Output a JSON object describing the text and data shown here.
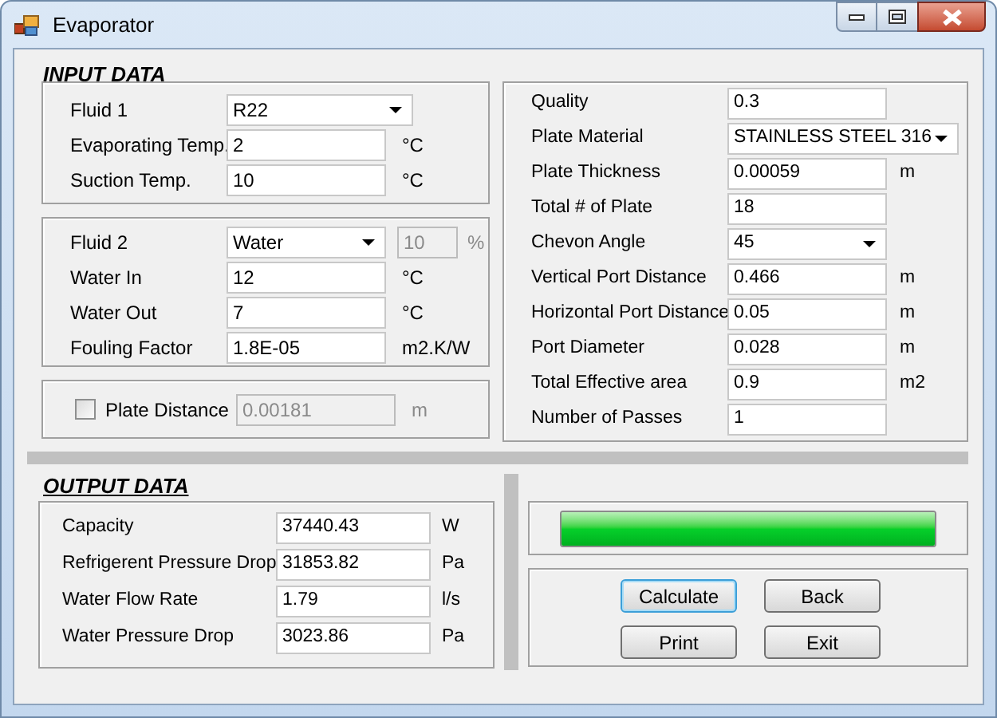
{
  "window": {
    "title": "Evaporator"
  },
  "input_heading": "INPUT DATA",
  "fluid1_group": {
    "fields": [
      {
        "label": "Fluid 1",
        "value": "R22",
        "kind": "combo"
      },
      {
        "label": "Evaporating Temp.",
        "value": "2",
        "unit": "°C",
        "kind": "text"
      },
      {
        "label": "Suction Temp.",
        "value": "10",
        "unit": "°C",
        "kind": "text"
      }
    ]
  },
  "fluid2_group": {
    "fields": [
      {
        "label": "Fluid 2",
        "value": "Water",
        "kind": "combo",
        "concentration": {
          "value": "10",
          "unit": "%",
          "disabled": true
        }
      },
      {
        "label": "Water In",
        "value": "12",
        "unit": "°C",
        "kind": "text"
      },
      {
        "label": "Water Out",
        "value": "7",
        "unit": "°C",
        "kind": "text"
      },
      {
        "label": "Fouling Factor",
        "value": "1.8E-05",
        "unit": "m2.K/W",
        "kind": "text"
      }
    ]
  },
  "plate_distance": {
    "label": "Plate Distance",
    "checked": false,
    "value": "0.00181",
    "unit": "m",
    "disabled": true
  },
  "plate_group": {
    "fields": [
      {
        "label": "Quality",
        "value": "0.3",
        "kind": "text"
      },
      {
        "label": "Plate Material",
        "value": "STAINLESS STEEL 316",
        "kind": "combo"
      },
      {
        "label": "Plate Thickness",
        "value": "0.00059",
        "unit": "m",
        "kind": "text"
      },
      {
        "label": "Total # of Plate",
        "value": "18",
        "kind": "text"
      },
      {
        "label": "Chevon Angle",
        "value": "45",
        "kind": "combo"
      },
      {
        "label": "Vertical Port Distance",
        "value": "0.466",
        "unit": "m",
        "kind": "text"
      },
      {
        "label": "Horizontal Port Distance",
        "value": "0.05",
        "unit": "m",
        "kind": "text"
      },
      {
        "label": "Port Diameter",
        "value": "0.028",
        "unit": "m",
        "kind": "text"
      },
      {
        "label": "Total Effective area",
        "value": "0.9",
        "unit": "m2",
        "kind": "text"
      },
      {
        "label": "Number of Passes",
        "value": "1",
        "kind": "text"
      }
    ]
  },
  "output_heading": "OUTPUT DATA",
  "output_group": {
    "fields": [
      {
        "label": "Capacity",
        "value": "37440.43",
        "unit": "W"
      },
      {
        "label": "Refrigerent Pressure Drop",
        "value": "31853.82",
        "unit": "Pa"
      },
      {
        "label": "Water Flow Rate",
        "value": "1.79",
        "unit": "l/s"
      },
      {
        "label": "Water Pressure Drop",
        "value": "3023.86",
        "unit": "Pa"
      }
    ]
  },
  "progress": {
    "level": 1.0
  },
  "buttons": [
    {
      "label": "Calculate",
      "focused": true
    },
    {
      "label": "Back",
      "focused": false
    },
    {
      "label": "Print",
      "focused": false
    },
    {
      "label": "Exit",
      "focused": false
    }
  ]
}
